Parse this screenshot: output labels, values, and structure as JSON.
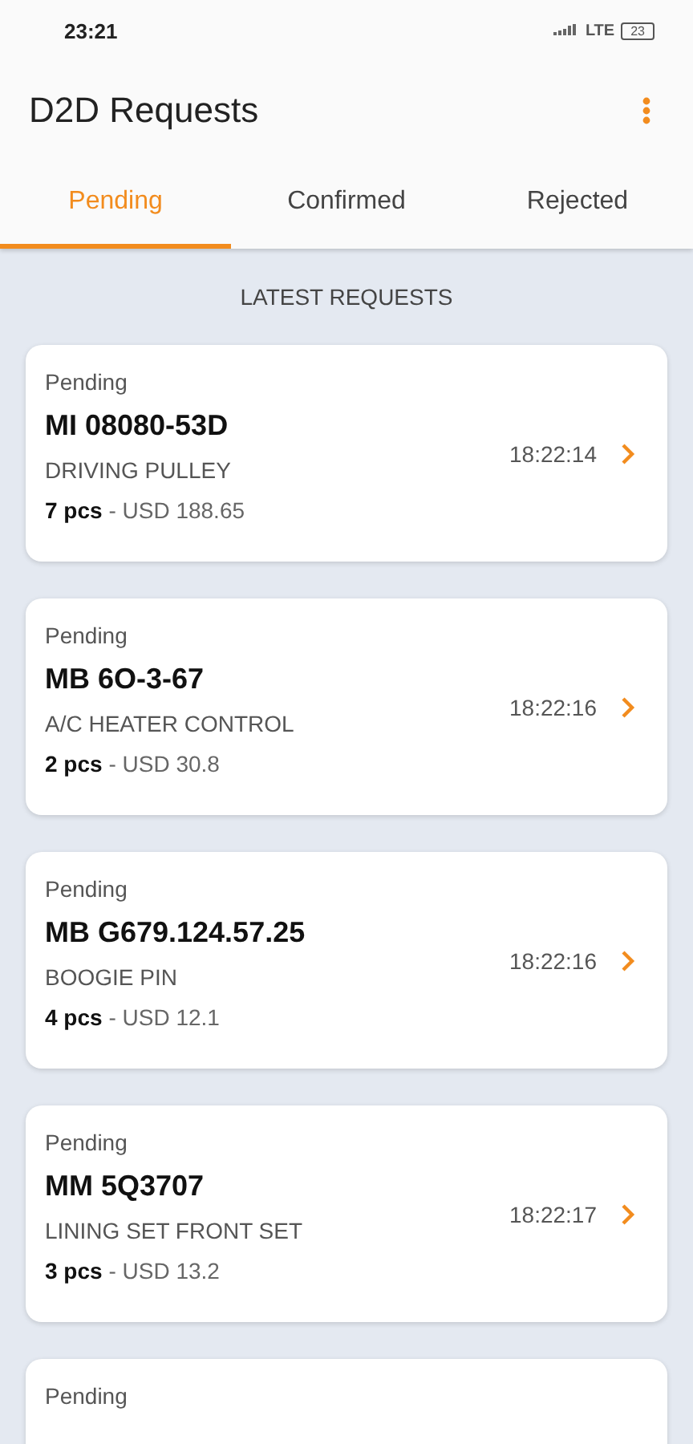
{
  "status_bar": {
    "time": "23:21",
    "network": "LTE",
    "battery": "23"
  },
  "app_bar": {
    "title": "D2D Requests"
  },
  "tabs": [
    {
      "label": "Pending",
      "selected": true
    },
    {
      "label": "Confirmed",
      "selected": false
    },
    {
      "label": "Rejected",
      "selected": false
    }
  ],
  "section_title": "LATEST REQUESTS",
  "requests": [
    {
      "status": "Pending",
      "code": "MI 08080-53D",
      "description": "DRIVING PULLEY",
      "quantity": "**7 pcs** - USD 188.65",
      "time": "18:22:14"
    },
    {
      "status": "Pending",
      "code": "MB 6O-3-67",
      "description": "A/C HEATER CONTROL",
      "quantity": "**2 pcs** - USD 30.8",
      "time": "18:22:16"
    },
    {
      "status": "Pending",
      "code": "MB G679.124.57.25",
      "description": "BOOGIE PIN",
      "quantity": "**4 pcs** - USD 12.1",
      "time": "18:22:16"
    },
    {
      "status": "Pending",
      "code": "MM 5Q3707",
      "description": "LINING SET FRONT SET",
      "quantity": "**3 pcs** - USD 13.2",
      "time": "18:22:17"
    },
    {
      "status": "Pending"
    }
  ]
}
